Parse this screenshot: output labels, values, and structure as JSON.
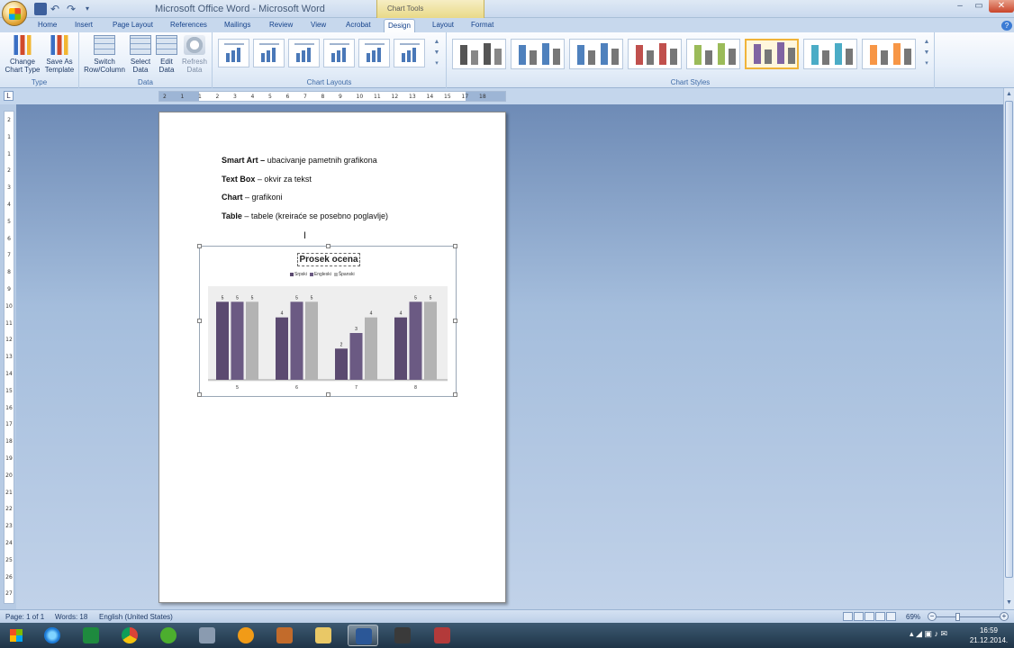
{
  "window": {
    "title": "Microsoft Office Word - Microsoft Word",
    "contextual_title": "Chart Tools",
    "controls": {
      "minimize": "‒",
      "maximize": "▭",
      "close": "✕"
    }
  },
  "quick_access": {
    "undo": "↶",
    "redo": "↷",
    "more": "▾"
  },
  "tabs": [
    "Home",
    "Insert",
    "Page Layout",
    "References",
    "Mailings",
    "Review",
    "View",
    "Acrobat",
    "Design",
    "Layout",
    "Format"
  ],
  "active_tab": "Design",
  "ribbon": {
    "type_group": {
      "label": "Type",
      "change_chart_type": "Change\nChart Type",
      "save_as_template": "Save As\nTemplate"
    },
    "data_group": {
      "label": "Data",
      "switch_row_column": "Switch\nRow/Column",
      "select_data": "Select\nData",
      "edit_data": "Edit\nData",
      "refresh_data": "Refresh\nData"
    },
    "chart_layouts": {
      "label": "Chart Layouts",
      "count": 6
    },
    "chart_styles": {
      "label": "Chart Styles",
      "selected_index": 5,
      "colors": [
        "#4d4d4d",
        "#4f81bd",
        "#4f81bd",
        "#c0504d",
        "#9bbb59",
        "#8064a2",
        "#4bacc6",
        "#f79646"
      ]
    }
  },
  "ruler": {
    "corner": "L",
    "h_ticks": [
      "2",
      "1",
      "1",
      "2",
      "3",
      "4",
      "5",
      "6",
      "7",
      "8",
      "9",
      "10",
      "11",
      "12",
      "13",
      "14",
      "15",
      "17",
      "18"
    ],
    "v_ticks": [
      "2",
      "1",
      "1",
      "2",
      "3",
      "4",
      "5",
      "6",
      "7",
      "8",
      "9",
      "10",
      "11",
      "12",
      "13",
      "14",
      "15",
      "16",
      "17",
      "18",
      "19",
      "20",
      "21",
      "22",
      "23",
      "24",
      "25",
      "26",
      "27"
    ]
  },
  "document": {
    "paragraphs": [
      {
        "bold": "Smart Art –",
        "text": " ubacivanje pametnih grafikona"
      },
      {
        "bold": "Text Box",
        "text": " – okvir za tekst"
      },
      {
        "bold": "Chart",
        "text": " – grafikoni"
      },
      {
        "bold": "Table",
        "text": " – tabele (kreiraće se posebno poglavlje)"
      }
    ]
  },
  "chart_data": {
    "type": "bar",
    "title": "Prosek ocena",
    "categories": [
      "5",
      "6",
      "7",
      "8"
    ],
    "series": [
      {
        "name": "Srpski",
        "values": [
          5,
          4,
          2,
          4
        ],
        "color": "#5b4a70"
      },
      {
        "name": "Engleski",
        "values": [
          5,
          5,
          3,
          5
        ],
        "color": "#6b5a83"
      },
      {
        "name": "Španski",
        "values": [
          5,
          5,
          4,
          5
        ],
        "color": "#b3b3b3"
      }
    ],
    "ylim": [
      0,
      6
    ],
    "legend": "top",
    "grid": false
  },
  "status": {
    "page": "Page: 1 of 1",
    "words": "Words: 18",
    "language": "English (United States)",
    "zoom": "69%",
    "zoom_minus": "−",
    "zoom_plus": "+"
  },
  "taskbar": {
    "apps": [
      "internet-explorer",
      "excel",
      "chrome",
      "utorrent",
      "tool-app",
      "avast",
      "script-app",
      "file-explorer",
      "word",
      "app-generic",
      "app-red"
    ],
    "active": "word",
    "clock_time": "16:59",
    "clock_date": "21.12.2014."
  }
}
